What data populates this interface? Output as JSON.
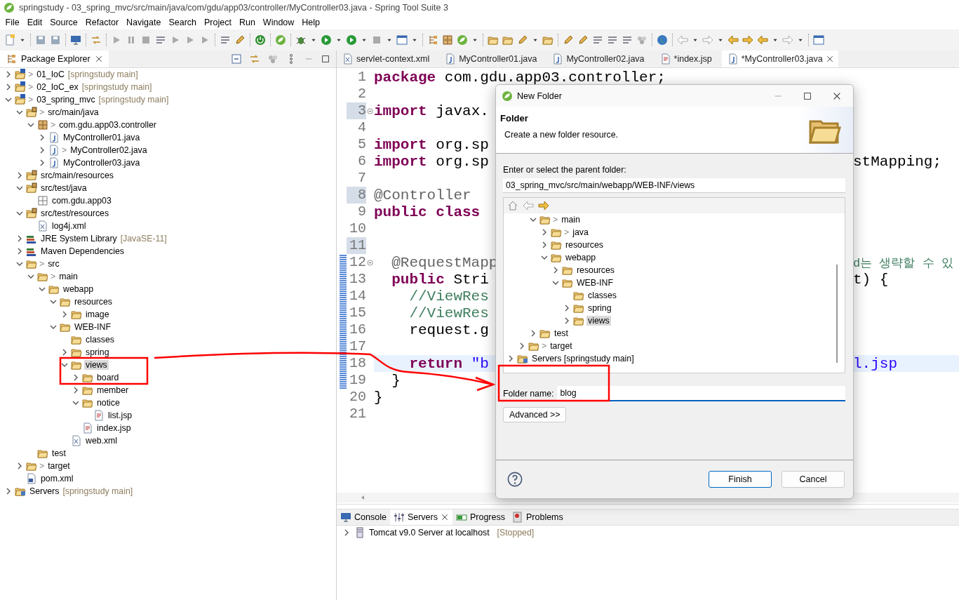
{
  "window": {
    "title": "springstudy - 03_spring_mvc/src/main/java/com/gdu/app03/controller/MyController03.java - Spring Tool Suite 3"
  },
  "menu": [
    "File",
    "Edit",
    "Source",
    "Refactor",
    "Navigate",
    "Search",
    "Project",
    "Run",
    "Window",
    "Help"
  ],
  "explorer": {
    "tab": "Package Explorer",
    "tree": [
      {
        "label": "01_IoC",
        "prefix": ">",
        "info": "[springstudy main]",
        "kind": "project",
        "expanded": false,
        "selected": false
      },
      {
        "label": "02_IoC_ex",
        "prefix": ">",
        "info": "[springstudy main]",
        "kind": "project",
        "expanded": false,
        "selected": false
      },
      {
        "label": "03_spring_mvc",
        "prefix": ">",
        "info": "[springstudy main]",
        "kind": "project",
        "expanded": true,
        "selected": false,
        "children": [
          {
            "label": "src/main/java",
            "prefix": ">",
            "kind": "source",
            "expanded": true,
            "selected": false,
            "children": [
              {
                "label": "com.gdu.app03.controller",
                "prefix": ">",
                "kind": "package",
                "expanded": true,
                "selected": false,
                "children": [
                  {
                    "label": "MyController01.java",
                    "kind": "java",
                    "expanded": false,
                    "selected": false
                  },
                  {
                    "label": "MyController02.java",
                    "prefix": ">",
                    "kind": "java",
                    "expanded": false,
                    "selected": false
                  },
                  {
                    "label": "MyController03.java",
                    "kind": "java",
                    "expanded": false,
                    "selected": false
                  }
                ]
              }
            ]
          },
          {
            "label": "src/main/resources",
            "kind": "source",
            "expanded": false,
            "selected": false
          },
          {
            "label": "src/test/java",
            "kind": "source",
            "expanded": true,
            "selected": false,
            "children": [
              {
                "label": "com.gdu.app03",
                "kind": "empty-package",
                "selected": false
              }
            ]
          },
          {
            "label": "src/test/resources",
            "kind": "source",
            "expanded": true,
            "selected": false,
            "children": [
              {
                "label": "log4j.xml",
                "kind": "xml",
                "selected": false
              }
            ]
          },
          {
            "label": "JRE System Library",
            "info": "[JavaSE-11]",
            "kind": "library",
            "expanded": false,
            "selected": false
          },
          {
            "label": "Maven Dependencies",
            "kind": "library",
            "expanded": false,
            "selected": false
          },
          {
            "label": "src",
            "prefix": ">",
            "kind": "folder",
            "expanded": true,
            "selected": false,
            "children": [
              {
                "label": "main",
                "prefix": ">",
                "kind": "folder",
                "expanded": true,
                "selected": false,
                "children": [
                  {
                    "label": "webapp",
                    "kind": "folder",
                    "expanded": true,
                    "selected": false,
                    "children": [
                      {
                        "label": "resources",
                        "kind": "folder",
                        "expanded": true,
                        "selected": false,
                        "children": [
                          {
                            "label": "image",
                            "kind": "folder",
                            "expanded": false,
                            "selected": false
                          }
                        ]
                      },
                      {
                        "label": "WEB-INF",
                        "kind": "folder",
                        "expanded": true,
                        "selected": false,
                        "children": [
                          {
                            "label": "classes",
                            "kind": "folder",
                            "selected": false
                          },
                          {
                            "label": "spring",
                            "kind": "folder",
                            "expanded": false,
                            "selected": false
                          },
                          {
                            "label": "views",
                            "kind": "folder",
                            "expanded": true,
                            "selected": true,
                            "children": [
                              {
                                "label": "board",
                                "kind": "folder",
                                "expanded": false,
                                "selected": false
                              },
                              {
                                "label": "member",
                                "kind": "folder",
                                "expanded": false,
                                "selected": false
                              },
                              {
                                "label": "notice",
                                "kind": "folder",
                                "expanded": true,
                                "selected": false,
                                "children": [
                                  {
                                    "label": "list.jsp",
                                    "kind": "jsp",
                                    "selected": false
                                  }
                                ]
                              },
                              {
                                "label": "index.jsp",
                                "kind": "jsp",
                                "selected": false
                              }
                            ]
                          },
                          {
                            "label": "web.xml",
                            "kind": "xml",
                            "selected": false
                          }
                        ]
                      }
                    ]
                  }
                ]
              },
              {
                "label": "test",
                "kind": "folder",
                "selected": false
              }
            ]
          },
          {
            "label": "target",
            "prefix": ">",
            "kind": "folder",
            "expanded": false,
            "selected": false
          },
          {
            "label": "pom.xml",
            "kind": "pom",
            "selected": false
          }
        ]
      },
      {
        "label": "Servers",
        "info": "[springstudy main]",
        "kind": "servers",
        "expanded": false,
        "selected": false
      }
    ]
  },
  "editor": {
    "tabs": [
      {
        "label": "servlet-context.xml",
        "kind": "xml",
        "selected": false
      },
      {
        "label": "MyController01.java",
        "kind": "java",
        "selected": false
      },
      {
        "label": "MyController02.java",
        "kind": "java",
        "selected": false
      },
      {
        "label": "*index.jsp",
        "kind": "jsp",
        "selected": false
      },
      {
        "label": "*MyController03.java",
        "kind": "java",
        "selected": true
      }
    ],
    "lines": [
      {
        "number": "1",
        "left": [
          {
            "text": "package",
            "kind": "keyword"
          },
          {
            "text": " com.gdu.app03.controller;",
            "kind": "plain"
          }
        ]
      },
      {
        "number": "2"
      },
      {
        "number": "3",
        "changed": true,
        "fold": true,
        "left": [
          {
            "text": "import",
            "kind": "keyword"
          },
          {
            "text": " javax.",
            "kind": "plain"
          }
        ]
      },
      {
        "number": "4"
      },
      {
        "number": "5",
        "left": [
          {
            "text": "import",
            "kind": "keyword"
          },
          {
            "text": " org.sp",
            "kind": "plain"
          }
        ]
      },
      {
        "number": "6",
        "left": [
          {
            "text": "import",
            "kind": "keyword"
          },
          {
            "text": " org.sp",
            "kind": "plain"
          }
        ],
        "right": [
          {
            "text": "stMapping;",
            "kind": "plain"
          }
        ]
      },
      {
        "number": "7"
      },
      {
        "number": "8",
        "changed": true,
        "left": [
          {
            "text": "@Controller",
            "kind": "annotation"
          }
        ]
      },
      {
        "number": "9",
        "left": [
          {
            "text": "public class",
            "kind": "keyword"
          }
        ]
      },
      {
        "number": "10"
      },
      {
        "number": "11",
        "changed": true
      },
      {
        "number": "12",
        "added": true,
        "fold": true,
        "left": [
          {
            "text": "  @RequestMapp",
            "kind": "annotation"
          }
        ],
        "right": [
          {
            "text": "d는 생략할 수 있",
            "kind": "comment"
          }
        ]
      },
      {
        "number": "13",
        "added": true,
        "left": [
          {
            "text": "  public",
            "kind": "keyword"
          },
          {
            "text": " Stri",
            "kind": "plain"
          }
        ],
        "right": [
          {
            "text": "t) {",
            "kind": "plain"
          }
        ]
      },
      {
        "number": "14",
        "added": true,
        "left": [
          {
            "text": "    //ViewRes",
            "kind": "comment"
          }
        ]
      },
      {
        "number": "15",
        "added": true,
        "left": [
          {
            "text": "    //ViewRes",
            "kind": "comment"
          }
        ]
      },
      {
        "number": "16",
        "added": true,
        "left": [
          {
            "text": "    request.g",
            "kind": "plain"
          }
        ]
      },
      {
        "number": "17",
        "added": true
      },
      {
        "number": "18",
        "added": true,
        "highlighted": true,
        "left": [
          {
            "text": "    return",
            "kind": "keyword"
          },
          {
            "text": " \"b",
            "kind": "string"
          }
        ],
        "right": [
          {
            "text": "l.jsp",
            "kind": "string"
          }
        ]
      },
      {
        "number": "19",
        "added": true,
        "left": [
          {
            "text": "  }",
            "kind": "plain"
          }
        ]
      },
      {
        "number": "20",
        "left": [
          {
            "text": "}",
            "kind": "plain"
          }
        ]
      },
      {
        "number": "21"
      }
    ]
  },
  "bottom_panel": {
    "tabs": [
      {
        "label": "Console",
        "kind": "console",
        "selected": false
      },
      {
        "label": "Servers",
        "kind": "servers",
        "selected": true
      },
      {
        "label": "Progress",
        "kind": "progress",
        "selected": false
      },
      {
        "label": "Problems",
        "kind": "problems",
        "selected": false
      }
    ],
    "servers": [
      {
        "label": "Tomcat v9.0 Server at localhost",
        "status": "[Stopped]",
        "expanded": false
      }
    ]
  },
  "dialog": {
    "title": "New Folder",
    "heading": "Folder",
    "description": "Create a new folder resource.",
    "parent_label": "Enter or select the parent folder:",
    "parent_value": "03_spring_mvc/src/main/webapp/WEB-INF/views",
    "tree": [
      {
        "children": [
          {
            "children": [
              {
                "label": "main",
                "prefix": ">",
                "kind": "folder",
                "expanded": true,
                "selected": false,
                "children": [
                  {
                    "label": "java",
                    "prefix": ">",
                    "kind": "folder",
                    "expanded": false,
                    "selected": false
                  },
                  {
                    "label": "resources",
                    "kind": "folder",
                    "expanded": false,
                    "selected": false
                  },
                  {
                    "label": "webapp",
                    "kind": "folder",
                    "expanded": true,
                    "selected": false,
                    "children": [
                      {
                        "label": "resources",
                        "kind": "folder",
                        "expanded": false,
                        "selected": false
                      },
                      {
                        "label": "WEB-INF",
                        "kind": "folder",
                        "expanded": true,
                        "selected": false,
                        "children": [
                          {
                            "label": "classes",
                            "kind": "folder",
                            "selected": false
                          },
                          {
                            "label": "spring",
                            "kind": "folder",
                            "expanded": false,
                            "selected": false
                          },
                          {
                            "label": "views",
                            "kind": "folder",
                            "expanded": false,
                            "selected": true
                          }
                        ]
                      }
                    ]
                  }
                ]
              },
              {
                "label": "test",
                "kind": "folder",
                "expanded": false,
                "selected": false
              }
            ]
          },
          {
            "label": "target",
            "prefix": ">",
            "kind": "folder",
            "expanded": false,
            "selected": false
          }
        ]
      },
      {
        "label": "Servers [springstudy main]",
        "kind": "servers",
        "expanded": false,
        "selected": false
      }
    ],
    "name_label": "Folder name:",
    "name_value": "blog",
    "advanced_button": "Advanced >>",
    "buttons": [
      {
        "label": "Finish",
        "default": true
      },
      {
        "label": "Cancel",
        "default": false
      }
    ]
  }
}
